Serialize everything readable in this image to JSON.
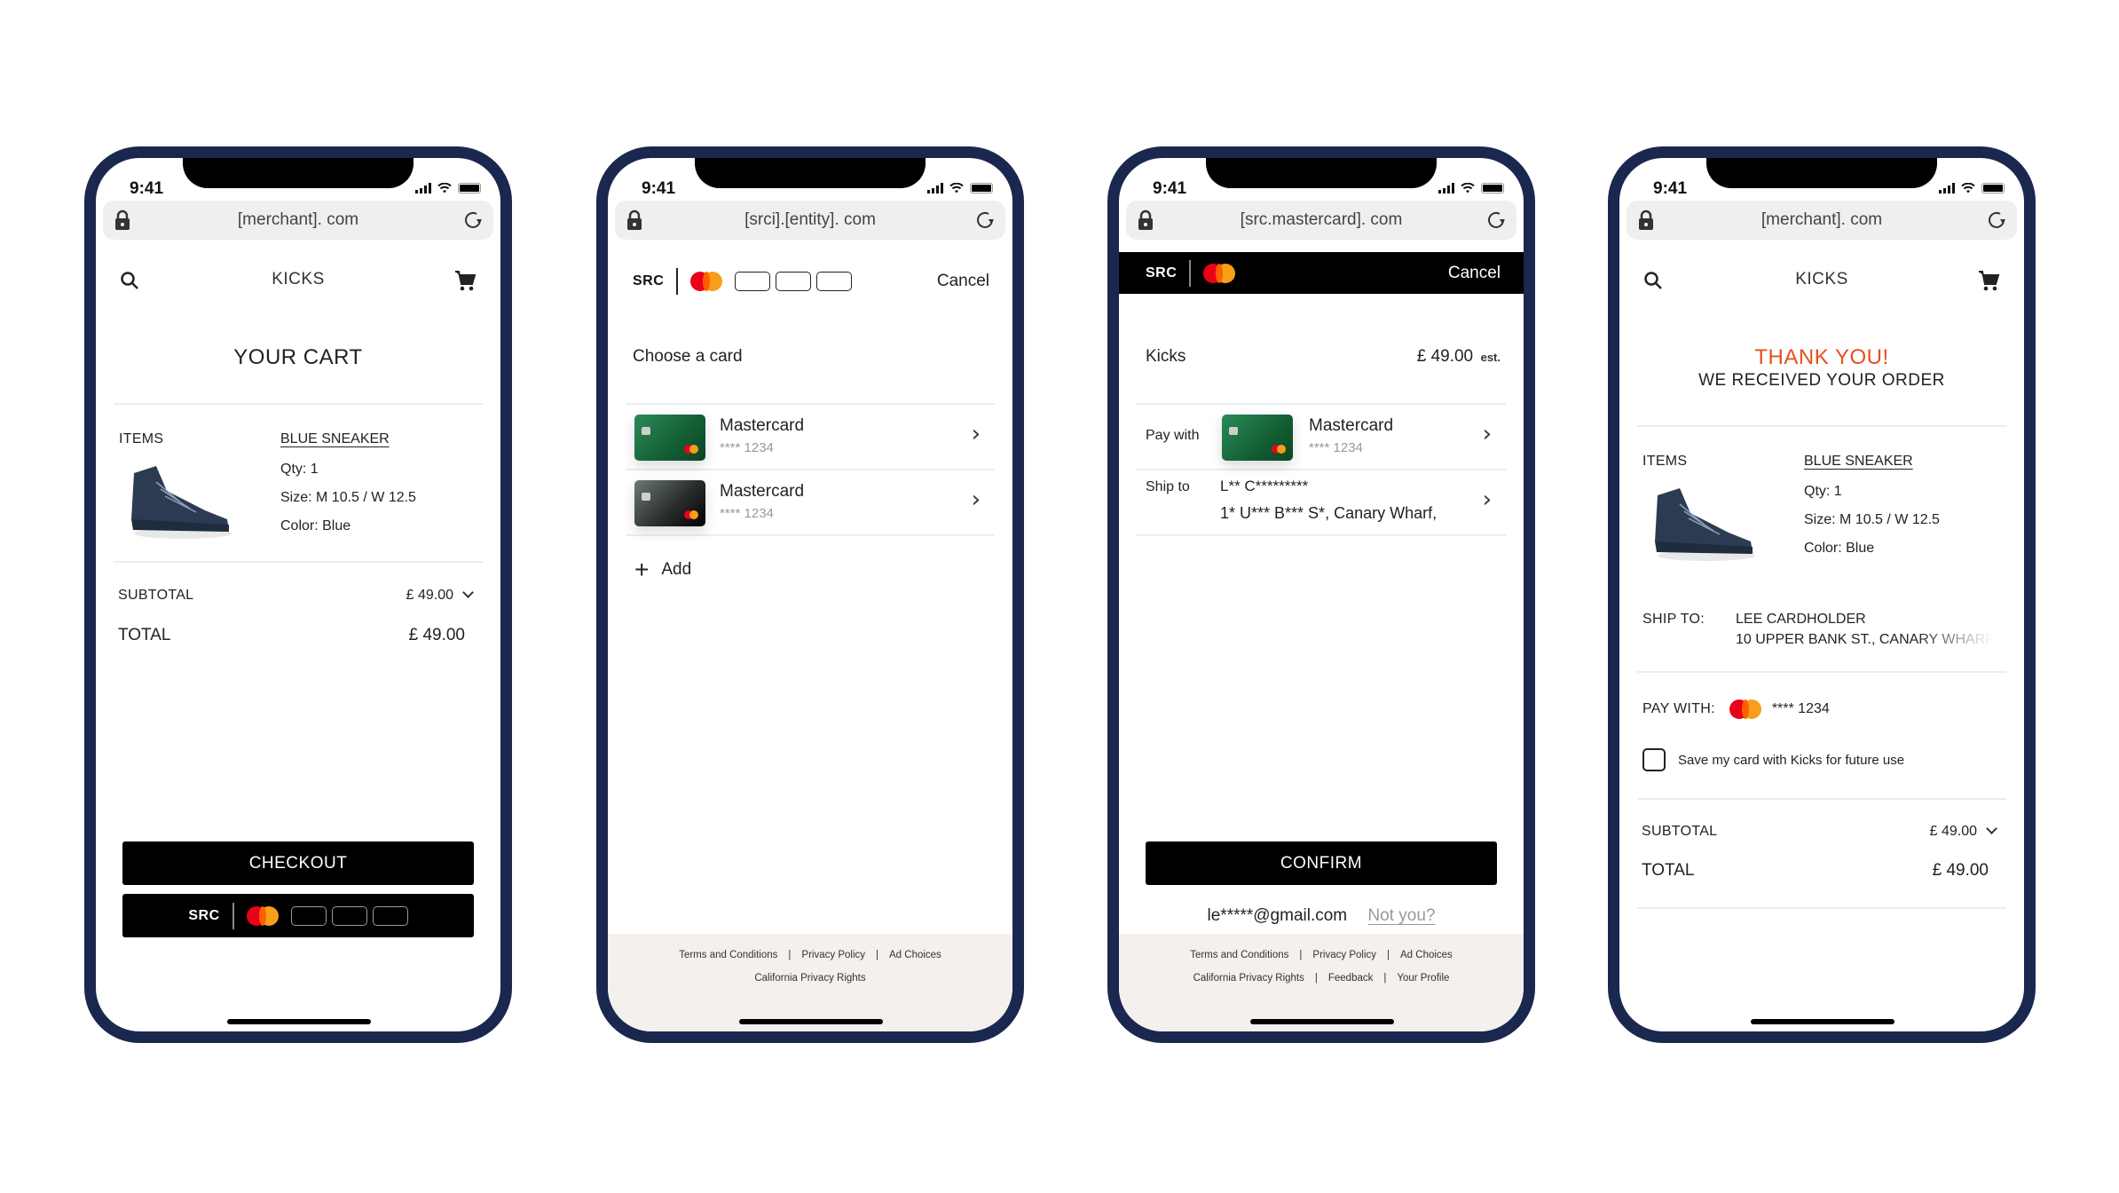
{
  "status_bar": {
    "time": "9:41"
  },
  "screens": [
    {
      "url": "[merchant]. com",
      "header_brand": "KICKS",
      "title": "YOUR CART",
      "items_label": "ITEMS",
      "product": {
        "name": "BLUE SNEAKER",
        "qty": "Qty: 1",
        "size": "Size: M 10.5 / W 12.5",
        "color": "Color: Blue"
      },
      "subtotal_label": "SUBTOTAL",
      "subtotal_value": "£ 49.00",
      "total_label": "TOTAL",
      "total_value": "£ 49.00",
      "checkout_button": "CHECKOUT",
      "src_button_label": "SRC"
    },
    {
      "url": "[srci].[entity]. com",
      "src_label": "SRC",
      "cancel": "Cancel",
      "heading": "Choose a card",
      "cards": [
        {
          "name": "Mastercard",
          "number": "**** 1234",
          "color": "green"
        },
        {
          "name": "Mastercard",
          "number": "**** 1234",
          "color": "black"
        }
      ],
      "add_label": "Add",
      "footer": {
        "line1": [
          "Terms and Conditions",
          "Privacy Policy",
          "Ad Choices"
        ],
        "line2": [
          "California Privacy Rights"
        ]
      }
    },
    {
      "url": "[src.mastercard]. com",
      "src_label": "SRC",
      "cancel": "Cancel",
      "merchant": "Kicks",
      "amount": "£ 49.00",
      "amount_suffix": "est.",
      "pay_with_label": "Pay with",
      "pay_card": {
        "name": "Mastercard",
        "number": "**** 1234"
      },
      "ship_to_label": "Ship to",
      "ship_name": "L** C*********",
      "ship_address": "1* U*** B*** S*, Canary Wharf,",
      "confirm_button": "CONFIRM",
      "email": "le*****@gmail.com",
      "not_you": "Not you?",
      "footer": {
        "line1": [
          "Terms and Conditions",
          "Privacy Policy",
          "Ad Choices"
        ],
        "line2": [
          "California Privacy Rights",
          "Feedback",
          "Your Profile"
        ]
      }
    },
    {
      "url": "[merchant]. com",
      "header_brand": "KICKS",
      "thank_you": "THANK YOU!",
      "received": "WE RECEIVED YOUR ORDER",
      "items_label": "ITEMS",
      "product": {
        "name": "BLUE SNEAKER",
        "qty": "Qty: 1",
        "size": "Size: M 10.5 / W 12.5",
        "color": "Color: Blue"
      },
      "ship_to_label": "SHIP TO:",
      "ship_name": "LEE CARDHOLDER",
      "ship_address": "10 UPPER BANK ST., CANARY WHARF",
      "pay_with_label": "PAY WITH:",
      "pay_number": "**** 1234",
      "save_card_label": "Save my card with Kicks for future use",
      "save_card_checked": false,
      "subtotal_label": "SUBTOTAL",
      "subtotal_value": "£ 49.00",
      "total_label": "TOTAL",
      "total_value": "£ 49.00"
    }
  ],
  "colors": {
    "frame": "#1a2850",
    "accent_thank_you": "#e4501c",
    "mastercard_red": "#eb001b",
    "mastercard_yellow": "#f79e1b",
    "footer_bg": "#f3f0ed"
  }
}
